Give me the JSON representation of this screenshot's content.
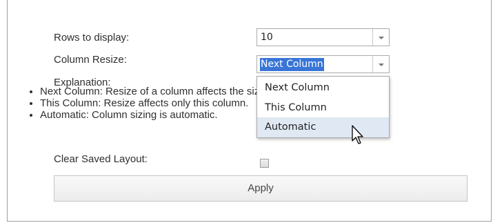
{
  "form": {
    "rows_label": "Rows to display:",
    "rows_value": "10",
    "resize_label": "Column Resize:",
    "resize_value": "Next Column",
    "explanation_label": "Explanation:",
    "explanations": [
      "Next Column: Resize of a column affects the size of the next column.",
      "This Column: Resize affects only this column.",
      "Automatic: Column sizing is automatic."
    ],
    "clear_label": "Clear Saved Layout:",
    "clear_checked": false,
    "apply_label": "Apply"
  },
  "dropdown": {
    "options": [
      "Next Column",
      "This Column",
      "Automatic"
    ],
    "hovered": "Automatic"
  },
  "icons": {
    "dropdown_arrow": "chevron-down-icon",
    "cursor": "mouse-pointer-icon"
  },
  "colors": {
    "selection": "#3875d7",
    "hover_option": "#dfe8f3"
  }
}
